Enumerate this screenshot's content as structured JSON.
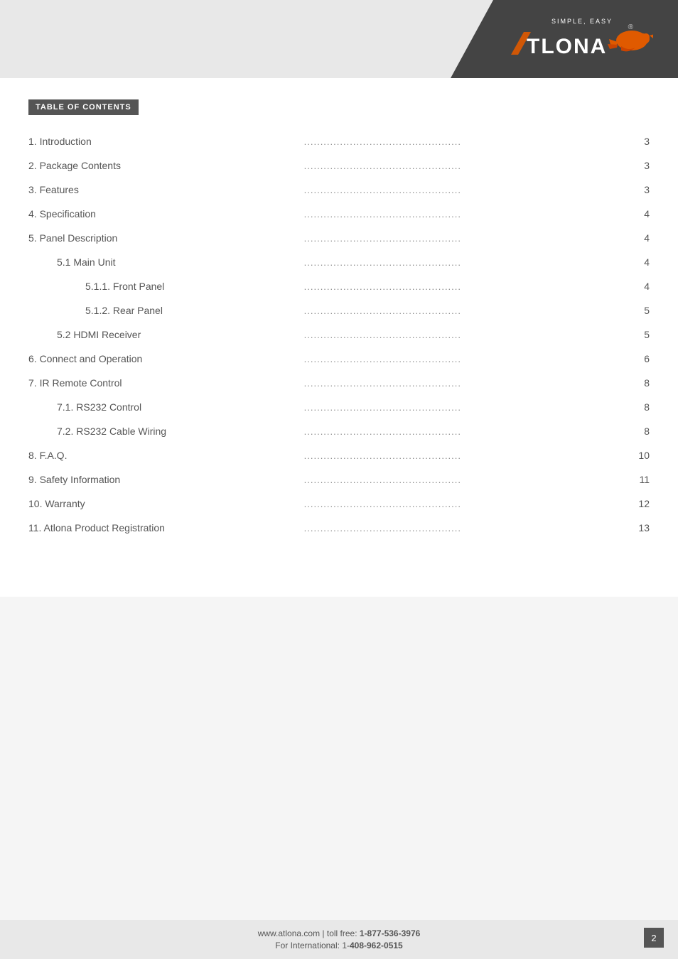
{
  "header": {
    "logo_simple_easy": "SIMPLE, EASY",
    "logo_name": "ATLONA",
    "registered": "®"
  },
  "toc": {
    "heading": "TABLE OF CONTENTS",
    "items": [
      {
        "label": "1. Introduction",
        "indent": 0,
        "page": "3"
      },
      {
        "label": "2. Package Contents",
        "indent": 0,
        "page": "3"
      },
      {
        "label": "3. Features",
        "indent": 0,
        "page": "3"
      },
      {
        "label": "4. Specification",
        "indent": 0,
        "page": "4"
      },
      {
        "label": "5. Panel Description",
        "indent": 0,
        "page": "4"
      },
      {
        "label": "5.1 Main Unit",
        "indent": 1,
        "page": "4"
      },
      {
        "label": "5.1.1. Front Panel",
        "indent": 2,
        "page": "4"
      },
      {
        "label": "5.1.2. Rear Panel",
        "indent": 2,
        "page": "5"
      },
      {
        "label": "5.2 HDMI Receiver",
        "indent": 1,
        "page": "5"
      },
      {
        "label": "6. Connect and Operation",
        "indent": 0,
        "page": "6"
      },
      {
        "label": "7. IR Remote Control",
        "indent": 0,
        "page": "8"
      },
      {
        "label": "7.1. RS232 Control",
        "indent": 1,
        "page": "8"
      },
      {
        "label": "7.2. RS232 Cable Wiring",
        "indent": 1,
        "page": "8"
      },
      {
        "label": "8. F.A.Q.",
        "indent": 0,
        "page": "10"
      },
      {
        "label": "9. Safety Information",
        "indent": 0,
        "page": "11"
      },
      {
        "label": "10. Warranty",
        "indent": 0,
        "page": "12"
      },
      {
        "label": "11. Atlona Product Registration",
        "indent": 0,
        "page": "13"
      }
    ],
    "dots": "................................................"
  },
  "footer": {
    "line1_prefix": "www.atlona.com | toll free: ",
    "line1_bold": "1-877-536-3976",
    "line2_prefix": "For International: 1-",
    "line2_bold": "408-962-0515"
  },
  "page_number": "2"
}
